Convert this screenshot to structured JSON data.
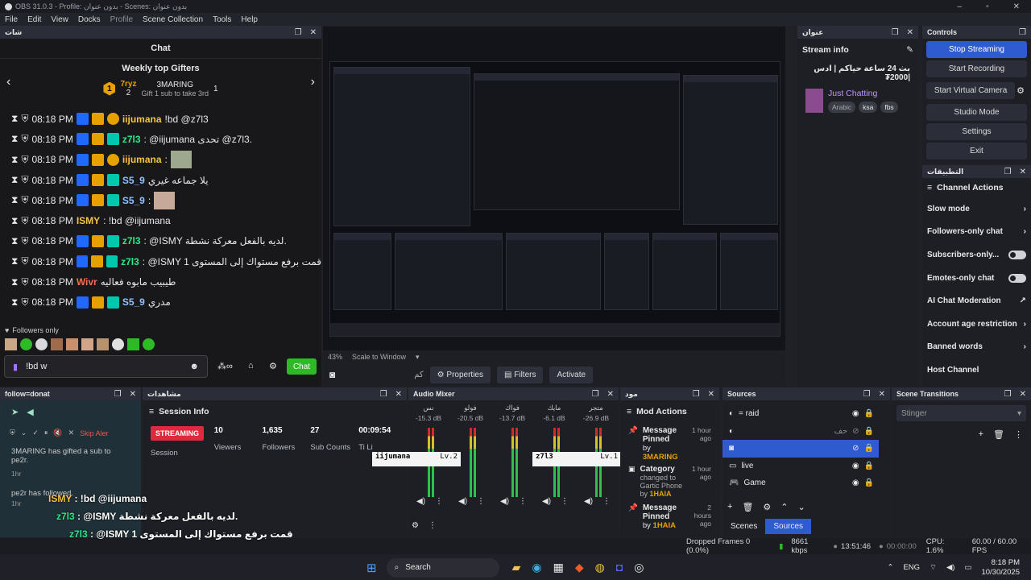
{
  "window": {
    "title": "OBS 31.0.3 - Profile: بدون عنوان - Scenes: بدون عنوان"
  },
  "menu": [
    "File",
    "Edit",
    "View",
    "Docks",
    "Profile",
    "Scene Collection",
    "Tools",
    "Help"
  ],
  "chat": {
    "dock_title": "شات",
    "title": "Chat",
    "gifters_title": "Weekly top Gifters",
    "gifter1": "7ryz",
    "gifter1_count": "2",
    "gifter2": "3MARING",
    "gifter2_count": "1",
    "gift_prompt": "Gift 1 sub to take 3rd",
    "messages": [
      {
        "time": "08:18 PM",
        "user": "iijumana",
        "color": "#f5c542",
        "text": "!bd @z7l3"
      },
      {
        "time": "08:18 PM",
        "user": "z7l3",
        "color": "#2ee88a",
        "text": ": @iijumana تحدى @z7l3."
      },
      {
        "time": "08:18 PM",
        "user": "iijumana",
        "color": "#f5c542",
        "text": ":"
      },
      {
        "time": "08:18 PM",
        "user": "S5_9",
        "color": "#8ec3ff",
        "text": "يلا جماعه غيري"
      },
      {
        "time": "08:18 PM",
        "user": "S5_9",
        "color": "#8ec3ff",
        "text": ":"
      },
      {
        "time": "08:18 PM",
        "user": "ISMY",
        "color": "#f5c542",
        "text": ": !bd @iijumana"
      },
      {
        "time": "08:18 PM",
        "user": "z7l3",
        "color": "#2ee88a",
        "text": ": @ISMY لديه بالفعل معركة نشطة."
      },
      {
        "time": "08:18 PM",
        "user": "z7l3",
        "color": "#2ee88a",
        "text": ": @ISMY قمت برفع مستواك إلى المستوى 1"
      },
      {
        "time": "08:18 PM",
        "user": "Wivr",
        "color": "#ff6b4a",
        "text": "طيبيب مابوه فعاليه"
      },
      {
        "time": "08:18 PM",
        "user": "S5_9",
        "color": "#8ec3ff",
        "text": "مدري"
      }
    ],
    "followers_only": "Followers only",
    "input_value": "!bd w",
    "send_label": "Chat"
  },
  "preview": {
    "zoom": "43%",
    "scale_mode": "Scale to Window"
  },
  "source_toolbar": {
    "properties": "Properties",
    "filters": "Filters",
    "activate": "Activate",
    "current": "كم"
  },
  "stream_info": {
    "dock_title": "عنوان",
    "title": "Stream info",
    "stream_title": "بث 24 ساعة حياكم | ادس |2000₮",
    "category": "Just Chatting",
    "tags": [
      "Arabic",
      "ksa",
      "fbs"
    ]
  },
  "controls": {
    "title": "Controls",
    "buttons": [
      "Stop Streaming",
      "Start Recording",
      "Start Virtual Camera",
      "Studio Mode",
      "Settings",
      "Exit"
    ]
  },
  "channel_actions": {
    "dock_title": "التطبيقات",
    "title": "Channel Actions",
    "items": [
      "Slow mode",
      "Followers-only chat",
      "Subscribers-only...",
      "Emotes-only chat",
      "AI Chat Moderation",
      "Account age restriction",
      "Banned words",
      "Host Channel"
    ]
  },
  "follow_dock": {
    "title": "follow=donat",
    "skip_alert": "Skip Aler",
    "event1": "3MARING has gifted a sub to pe2r.",
    "event1_time": "1hr",
    "event2": "pe2r has followed.",
    "event2_time": "1hr"
  },
  "session": {
    "dock_title": "مشاهدات",
    "title": "Session Info",
    "status": "STREAMING",
    "session_label": "Session",
    "viewers": "10",
    "viewers_label": "Viewers",
    "followers": "1,635",
    "followers_label": "Followers",
    "subs": "27",
    "subs_label": "Sub Counts",
    "time": "00:09:54",
    "time_label": "Ti Li"
  },
  "mixer": {
    "title": "Audio Mixer",
    "channels": [
      {
        "name": "نس",
        "db": "-15.3 dB"
      },
      {
        "name": "فولو",
        "db": "-20.5 dB"
      },
      {
        "name": "فواك",
        "db": "-13.7 dB"
      },
      {
        "name": "مايك",
        "db": "-6.1 dB"
      },
      {
        "name": "متجر",
        "db": "-26.9 dB"
      }
    ],
    "overlay1": "iijumana",
    "overlay1_lv": "Lv.2",
    "overlay2": "z7l3",
    "overlay2_lv": "Lv.1",
    "scale": [
      "0",
      "-5",
      "-10",
      "-15",
      "-20",
      "-25",
      "-30",
      "-35",
      "-40",
      "-45",
      "-50",
      "-55",
      "-60"
    ]
  },
  "mod": {
    "dock_title": "مود",
    "title": "Mod Actions",
    "items": [
      {
        "title": "Message Pinned",
        "by": "by",
        "user": "3MARING",
        "time": "1 hour ago"
      },
      {
        "title": "Category",
        "by": "changed to Gartic Phone by",
        "user": "1HAIA",
        "time": "1 hour ago"
      },
      {
        "title": "Message Pinned",
        "by": "by",
        "user": "1HAIA",
        "time": "2 hours ago"
      }
    ]
  },
  "sources": {
    "title": "Sources",
    "items": [
      "= raid",
      "حف",
      "",
      "live",
      "Game"
    ],
    "tab_scenes": "Scenes",
    "tab_sources": "Sources"
  },
  "transitions": {
    "title": "Scene Transitions",
    "selected": "Stinger"
  },
  "status": {
    "dropped": "Dropped Frames 0 (0.0%)",
    "bitrate": "8661 kbps",
    "live_time": "13:51:46",
    "rec_time": "00:00:00",
    "cpu": "CPU: 1.6%",
    "fps": "60.00 / 60.00 FPS"
  },
  "taskbar": {
    "search": "Search",
    "lang": "ENG",
    "time": "8:18 PM",
    "date": "10/30/2025"
  },
  "colors": {
    "accent": "#2f5bd1",
    "streaming": "#e0283e",
    "twitch_green": "#2eba27"
  }
}
